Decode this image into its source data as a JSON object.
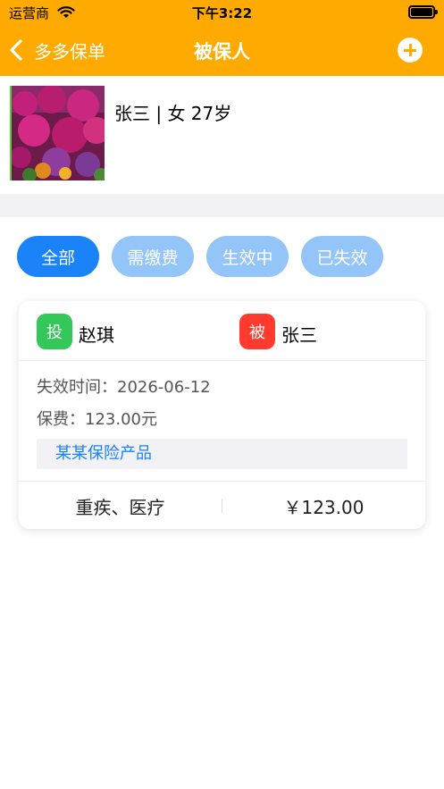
{
  "status_bar": {
    "carrier": "运营商",
    "time": "下午3:22"
  },
  "nav": {
    "back_label": "多多保单",
    "title": "被保人",
    "add_icon": "plus-circle-icon"
  },
  "profile": {
    "name_line": "张三 | 女 27岁"
  },
  "filters": [
    {
      "label": "全部",
      "active": true
    },
    {
      "label": "需缴费",
      "active": false
    },
    {
      "label": "生效中",
      "active": false
    },
    {
      "label": "已失效",
      "active": false
    }
  ],
  "policy": {
    "holder_badge": "投",
    "holder_name": "赵琪",
    "insured_badge": "被",
    "insured_name": "张三",
    "expire_text": "失效时间：2026-06-12",
    "premium_text": "保费：123.00元",
    "product_name": "某某保险产品",
    "coverage": "重疾、医疗",
    "amount": "￥123.00"
  },
  "colors": {
    "nav_bg": "#FFAA00",
    "tab_active": "#1A83F7",
    "tab_inactive": "#93C5F8",
    "holder_badge": "#34C759",
    "insured_badge": "#FF3B30",
    "product_text": "#1A83F7"
  }
}
